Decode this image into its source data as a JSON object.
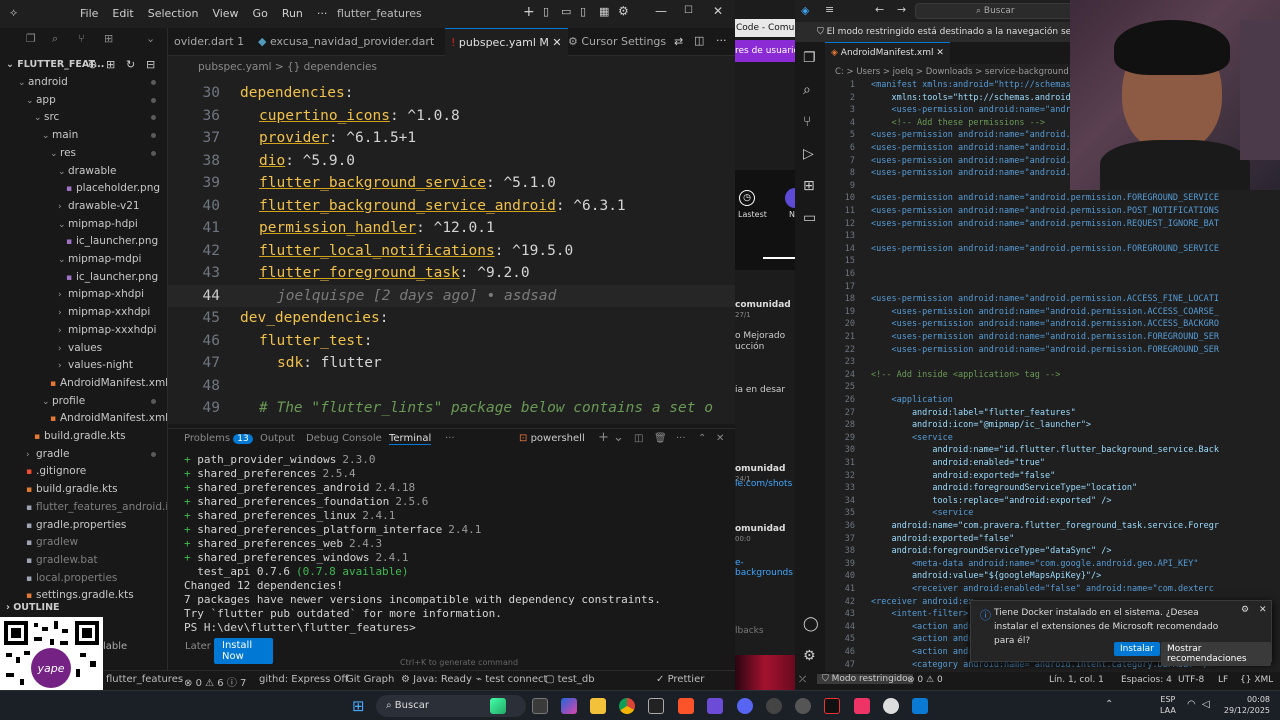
{
  "ide": {
    "menu": [
      "File",
      "Edit",
      "Selection",
      "View",
      "Go",
      "Run",
      "···"
    ],
    "title": "flutter_features",
    "explorer_title": "FLUTTER_FEAT...",
    "tree": [
      {
        "label": "android",
        "depth": 0,
        "folder": true,
        "open": true
      },
      {
        "label": "app",
        "depth": 1,
        "folder": true,
        "open": true
      },
      {
        "label": "src",
        "depth": 2,
        "folder": true,
        "open": true
      },
      {
        "label": "main",
        "depth": 3,
        "folder": true,
        "open": true
      },
      {
        "label": "res",
        "depth": 4,
        "folder": true,
        "open": true
      },
      {
        "label": "drawable",
        "depth": 5,
        "folder": true,
        "open": true
      },
      {
        "label": "placeholder.png",
        "depth": 6,
        "folder": false
      },
      {
        "label": "drawable-v21",
        "depth": 5,
        "folder": true,
        "open": false
      },
      {
        "label": "mipmap-hdpi",
        "depth": 5,
        "folder": true,
        "open": true
      },
      {
        "label": "ic_launcher.png",
        "depth": 6,
        "folder": false
      },
      {
        "label": "mipmap-mdpi",
        "depth": 5,
        "folder": true,
        "open": true
      },
      {
        "label": "ic_launcher.png",
        "depth": 6,
        "folder": false
      },
      {
        "label": "mipmap-xhdpi",
        "depth": 5,
        "folder": true,
        "open": false
      },
      {
        "label": "mipmap-xxhdpi",
        "depth": 5,
        "folder": true,
        "open": false
      },
      {
        "label": "mipmap-xxxhdpi",
        "depth": 5,
        "folder": true,
        "open": false
      },
      {
        "label": "values",
        "depth": 5,
        "folder": true,
        "open": false
      },
      {
        "label": "values-night",
        "depth": 5,
        "folder": true,
        "open": false
      },
      {
        "label": "AndroidManifest.xml",
        "depth": 4,
        "folder": false
      },
      {
        "label": "profile",
        "depth": 3,
        "folder": true,
        "open": true
      },
      {
        "label": "AndroidManifest.xml",
        "depth": 4,
        "folder": false
      },
      {
        "label": "build.gradle.kts",
        "depth": 2,
        "folder": false
      },
      {
        "label": "gradle",
        "depth": 1,
        "folder": true,
        "open": false
      },
      {
        "label": ".gitignore",
        "depth": 1,
        "folder": false
      },
      {
        "label": "build.gradle.kts",
        "depth": 1,
        "folder": false
      },
      {
        "label": "flutter_features_android.iml",
        "depth": 1,
        "folder": false
      },
      {
        "label": "gradle.properties",
        "depth": 1,
        "folder": false
      },
      {
        "label": "gradlew",
        "depth": 1,
        "folder": false
      },
      {
        "label": "gradlew.bat",
        "depth": 1,
        "folder": false
      },
      {
        "label": "local.properties",
        "depth": 1,
        "folder": false
      },
      {
        "label": "settings.gradle.kts",
        "depth": 1,
        "folder": false
      }
    ],
    "outline_label": "OUTLINE",
    "tabs": [
      "ovider.dart 1",
      "excusa_navidad_provider.dart",
      "pubspec.yaml M",
      "Cursor Settings"
    ],
    "breadcrumb": "pubspec.yaml > {} dependencies",
    "code": [
      {
        "n": "30",
        "key": "dependencies",
        "val": ":"
      },
      {
        "n": "36",
        "pkg": "cupertino_icons",
        "val": ": ^1.0.8"
      },
      {
        "n": "37",
        "pkg": "provider",
        "val": ": ^6.1.5+1"
      },
      {
        "n": "38",
        "pkg": "dio",
        "val": ": ^5.9.0"
      },
      {
        "n": "39",
        "pkg": "flutter_background_service",
        "val": ": ^5.1.0"
      },
      {
        "n": "40",
        "pkg": "flutter_background_service_android",
        "val": ": ^6.3.1"
      },
      {
        "n": "41",
        "pkg": "permission_handler",
        "val": ": ^12.0.1"
      },
      {
        "n": "42",
        "pkg": "flutter_local_notifications",
        "val": ": ^19.5.0"
      },
      {
        "n": "43",
        "pkg": "flutter_foreground_task",
        "val": ": ^9.2.0"
      },
      {
        "n": "44",
        "blame": "joelquispe [2 days ago] • asdsad"
      },
      {
        "n": "45",
        "key": "dev_dependencies",
        "val": ":"
      },
      {
        "n": "46",
        "key2": "flutter_test",
        "val": ":"
      },
      {
        "n": "47",
        "key3": "sdk",
        "val": ": flutter"
      },
      {
        "n": "48"
      },
      {
        "n": "49",
        "comment": "# The \"flutter_lints\" package below contains a set o"
      }
    ],
    "panel_tabs": {
      "problems": "Problems",
      "problems_count": "13",
      "output": "Output",
      "debug": "Debug Console",
      "terminal": "Terminal",
      "shell": "powershell"
    },
    "terminal": [
      {
        "plus": true,
        "name": "path_provider_windows",
        "ver": "2.3.0"
      },
      {
        "plus": true,
        "name": "shared_preferences",
        "ver": "2.5.4"
      },
      {
        "plus": true,
        "name": "shared_preferences_android",
        "ver": "2.4.18"
      },
      {
        "plus": true,
        "name": "shared_preferences_foundation",
        "ver": "2.5.6"
      },
      {
        "plus": true,
        "name": "shared_preferences_linux",
        "ver": "2.4.1"
      },
      {
        "plus": true,
        "name": "shared_preferences_platform_interface",
        "ver": "2.4.1"
      },
      {
        "plus": true,
        "name": "shared_preferences_web",
        "ver": "2.4.3"
      },
      {
        "plus": true,
        "name": "shared_preferences_windows",
        "ver": "2.4.1"
      },
      {
        "plus": false,
        "name": "  test_api 0.7.6",
        "ver": "(0.7.8 available)"
      },
      {
        "plus": false,
        "name": "Changed 12 dependencies!",
        "ver": ""
      },
      {
        "plus": false,
        "name": "7 packages have newer versions incompatible with dependency constraints.",
        "ver": ""
      },
      {
        "plus": false,
        "name": "Try `flutter pub outdated` for more information.",
        "ver": ""
      },
      {
        "plus": false,
        "name": "PS H:\\dev\\flutter\\flutter_features> ",
        "ver": ""
      }
    ],
    "gen_hint": "Ctrl+K to generate command",
    "install_later": "Later",
    "install_now": "Install Now",
    "install_avail": "lable",
    "status": {
      "project": "flutter_features",
      "errors": "0",
      "warnings": "6",
      "info": "7",
      "githd": "githd: Express Off",
      "git_graph": "Git Graph",
      "java": "Java: Ready",
      "test_connect": "test connect",
      "test_db": "test_db",
      "prettier": "Prettier"
    }
  },
  "browser": {
    "tab_text": "Code - Comuni",
    "chip": "res de usuario",
    "lastest": "Lastest",
    "m": "N",
    "frag1": "comunidad",
    "frag1b": "27/1",
    "frag2": "o Mejorado",
    "frag3": "ucción",
    "frag4": "ia en desar",
    "frag5": "omunidad",
    "frag5b": "24/1",
    "frag6": "le.com/shots",
    "frag7": "omunidad",
    "frag7b": "00:0",
    "frag8": "e-backgrounds",
    "frag9": "lbacks"
  },
  "vscode": {
    "search_placeholder": "Buscar",
    "restricted": "El modo restringido está destinado a la navegación segura por el código",
    "tab": "AndroidManifest.xml",
    "breadcrumb": "C: > Users > joelq > Downloads > service-background > servi",
    "lines": [
      {
        "n": "1",
        "t": "<manifest xmlns:android=\"http://schemas"
      },
      {
        "n": "2",
        "t": "    xmlns:tools=\"http://schemas.android"
      },
      {
        "n": "3",
        "t": "    <uses-permission android:name=\"andr"
      },
      {
        "n": "4",
        "t": "    <!-- Add these permissions -->"
      },
      {
        "n": "5",
        "t": "<uses-permission android:name=\"android."
      },
      {
        "n": "6",
        "t": "<uses-permission android:name=\"android."
      },
      {
        "n": "7",
        "t": "<uses-permission android:name=\"android."
      },
      {
        "n": "8",
        "t": "<uses-permission android:name=\"android."
      },
      {
        "n": "9",
        "t": ""
      },
      {
        "n": "10",
        "t": "<uses-permission android:name=\"android.permission.FOREGROUND_SERVICE"
      },
      {
        "n": "11",
        "t": "<uses-permission android:name=\"android.permission.POST_NOTIFICATIONS"
      },
      {
        "n": "12",
        "t": "<uses-permission android:name=\"android.permission.REQUEST_IGNORE_BAT"
      },
      {
        "n": "13",
        "t": ""
      },
      {
        "n": "14",
        "t": "<uses-permission android:name=\"android.permission.FOREGROUND_SERVICE"
      },
      {
        "n": "15",
        "t": ""
      },
      {
        "n": "16",
        "t": ""
      },
      {
        "n": "17",
        "t": ""
      },
      {
        "n": "18",
        "t": "<uses-permission android:name=\"android.permission.ACCESS_FINE_LOCATI"
      },
      {
        "n": "19",
        "t": "    <uses-permission android:name=\"android.permission.ACCESS_COARSE_"
      },
      {
        "n": "20",
        "t": "    <uses-permission android:name=\"android.permission.ACCESS_BACKGRO"
      },
      {
        "n": "21",
        "t": "    <uses-permission android:name=\"android.permission.FOREGROUND_SER"
      },
      {
        "n": "22",
        "t": "    <uses-permission android:name=\"android.permission.FOREGROUND_SER"
      },
      {
        "n": "23",
        "t": ""
      },
      {
        "n": "24",
        "t": "<!-- Add inside <application> tag -->"
      },
      {
        "n": "25",
        "t": ""
      },
      {
        "n": "26",
        "t": "    <application"
      },
      {
        "n": "27",
        "t": "        android:label=\"flutter_features\""
      },
      {
        "n": "28",
        "t": "        android:icon=\"@mipmap/ic_launcher\">"
      },
      {
        "n": "29",
        "t": "        <service"
      },
      {
        "n": "30",
        "t": "            android:name=\"id.flutter.flutter_background_service.Back"
      },
      {
        "n": "31",
        "t": "            android:enabled=\"true\""
      },
      {
        "n": "32",
        "t": "            android:exported=\"false\""
      },
      {
        "n": "33",
        "t": "            android:foregroundServiceType=\"location\""
      },
      {
        "n": "34",
        "t": "            tools:replace=\"android:exported\" />"
      },
      {
        "n": "35",
        "t": "            <service"
      },
      {
        "n": "36",
        "t": "    android:name=\"com.pravera.flutter_foreground_task.service.Foregr"
      },
      {
        "n": "37",
        "t": "    android:exported=\"false\""
      },
      {
        "n": "38",
        "t": "    android:foregroundServiceType=\"dataSync\" />"
      },
      {
        "n": "39",
        "t": "        <meta-data android:name=\"com.google.android.geo.API_KEY\""
      },
      {
        "n": "40",
        "t": "        android:value=\"${googleMapsApiKey}\"/>"
      },
      {
        "n": "41",
        "t": "        <receiver android:enabled=\"false\" android:name=\"com.dexterc"
      },
      {
        "n": "42",
        "t": "<receiver android:ex"
      },
      {
        "n": "43",
        "t": "    <intent-filter>"
      },
      {
        "n": "44",
        "t": "        <action andr"
      },
      {
        "n": "45",
        "t": "        <action andr"
      },
      {
        "n": "46",
        "t": "        <action andr"
      },
      {
        "n": "47",
        "t": "        <category android:name=\"android.intent.category.DEFAULT\" />"
      }
    ],
    "notification": {
      "text": "Tiene Docker instalado en el sistema. ¿Desea instalar el extensiones de Microsoft recomendado para él?",
      "install": "Instalar",
      "recommend": "Mostrar recomendaciones"
    },
    "status": {
      "restricted": "Modo restringido",
      "errors": "0",
      "warnings": "0",
      "pos": "Lín. 1, col. 1",
      "spaces": "Espacios: 4",
      "enc": "UTF-8",
      "eol": "LF",
      "lang": "XML"
    }
  },
  "taskbar": {
    "search": "Buscar",
    "lang1": "ESP",
    "lang2": "LAA",
    "time": "00:08",
    "date": "29/12/2025"
  },
  "colors": {
    "accent": "#0078d4",
    "yaml_key": "#f0c14b",
    "git_added": "#3fb950"
  }
}
